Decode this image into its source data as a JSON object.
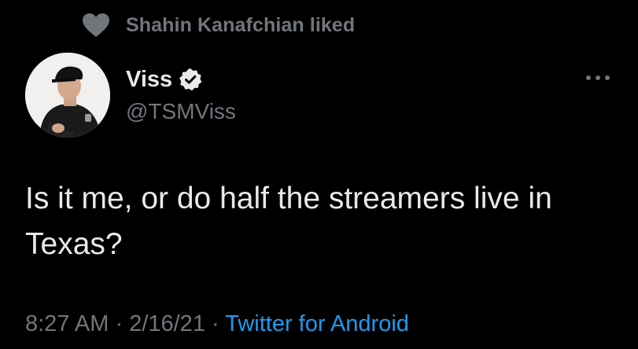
{
  "social_context": {
    "icon": "heart-icon",
    "text": "Shahin Kanafchian liked"
  },
  "author": {
    "display_name": "Viss",
    "verified": true,
    "verified_icon": "verified-badge-icon",
    "handle": "@TSMViss"
  },
  "more_icon": "more-options-icon",
  "tweet": {
    "text": "Is it me, or do half the streamers live in Texas?"
  },
  "meta": {
    "time": "8:27 AM",
    "separator": " · ",
    "date": "2/16/21",
    "source": "Twitter for Android"
  },
  "colors": {
    "background": "#000000",
    "text_primary": "#e7e9ea",
    "text_secondary": "#71767b",
    "link": "#1d9bf0"
  }
}
